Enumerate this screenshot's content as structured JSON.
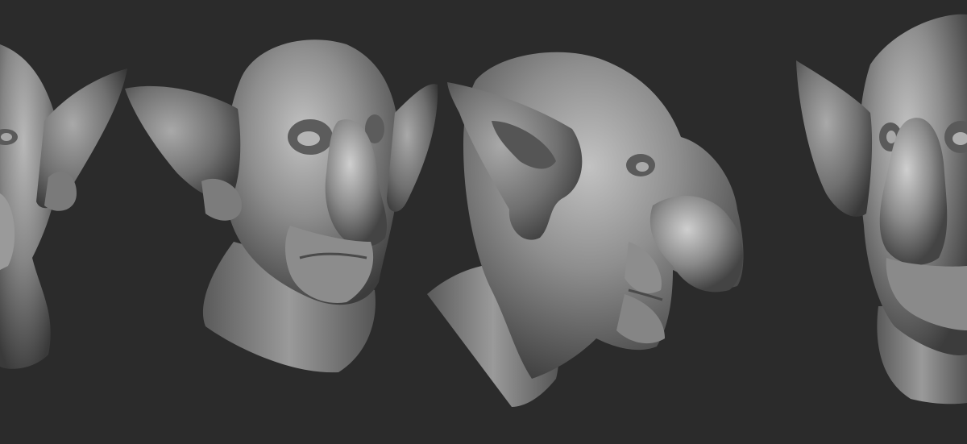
{
  "scene": {
    "background": "#2b2b2b",
    "clay_color": "#8a8a8a",
    "clay_highlight": "#bdbdbd",
    "clay_shadow": "#3a3a3a",
    "views": [
      {
        "id": "left-cropped",
        "orientation": "three-quarter",
        "cropped": "left"
      },
      {
        "id": "front",
        "orientation": "front"
      },
      {
        "id": "profile",
        "orientation": "side-right"
      },
      {
        "id": "right-cropped",
        "orientation": "three-quarter",
        "cropped": "right"
      }
    ]
  }
}
